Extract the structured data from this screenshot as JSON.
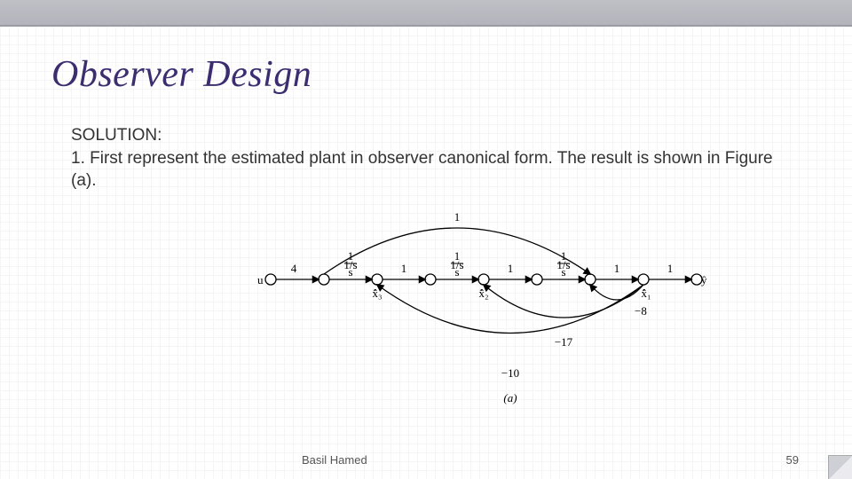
{
  "title": "Observer Design",
  "body": {
    "solution_label": "SOLUTION:",
    "step1": "1. First represent the estimated plant in observer canonical form. The result is shown in Figure (a)."
  },
  "diagram": {
    "labels": {
      "input": "u",
      "output": "ŷ"
    },
    "forward_gains": [
      "4",
      "1/s",
      "1",
      "1/s",
      "1",
      "1/s",
      "1",
      "1"
    ],
    "top_arc_gain": "1",
    "state_labels": [
      "x̂̇₃",
      "x̂̇₂",
      "x̂̇₁"
    ],
    "feedback_gains": [
      "−8",
      "−17",
      "−10"
    ],
    "caption": "(a)"
  },
  "footer": {
    "author": "Basil Hamed",
    "page": "59"
  }
}
